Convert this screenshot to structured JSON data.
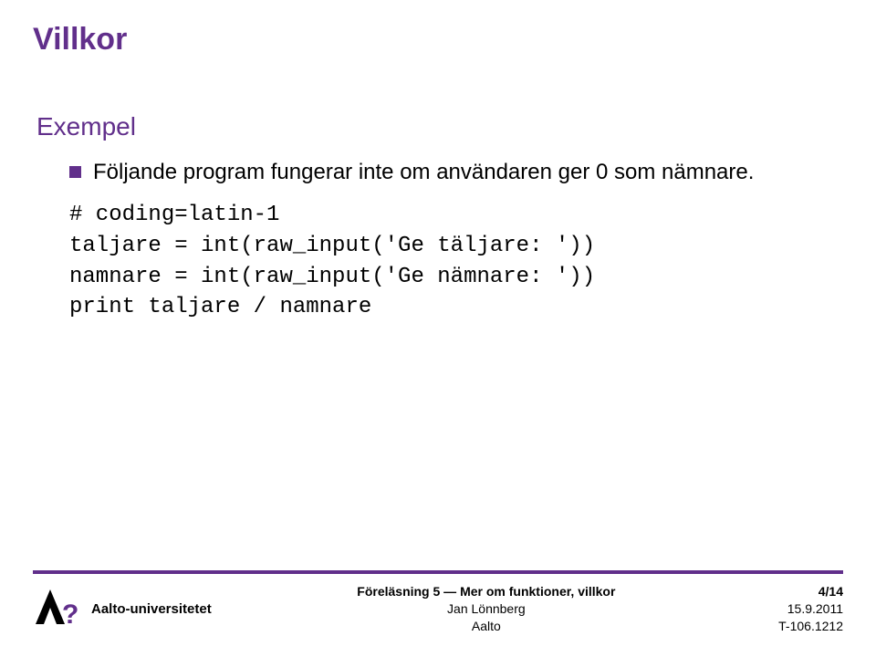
{
  "title": "Villkor",
  "subtitle": "Exempel",
  "bullet": "Följande program fungerar inte om användaren ger 0 som nämnare.",
  "code": "# coding=latin-1\ntaljare = int(raw_input('Ge täljare: '))\nnamnare = int(raw_input('Ge nämnare: '))\nprint taljare / namnare",
  "footer": {
    "university": "Aalto-universitetet",
    "lecture": "Föreläsning 5 — Mer om funktioner, villkor",
    "author": "Jan Lönnberg",
    "org": "Aalto",
    "page": "4/14",
    "date": "15.9.2011",
    "course": "T-106.1212"
  }
}
